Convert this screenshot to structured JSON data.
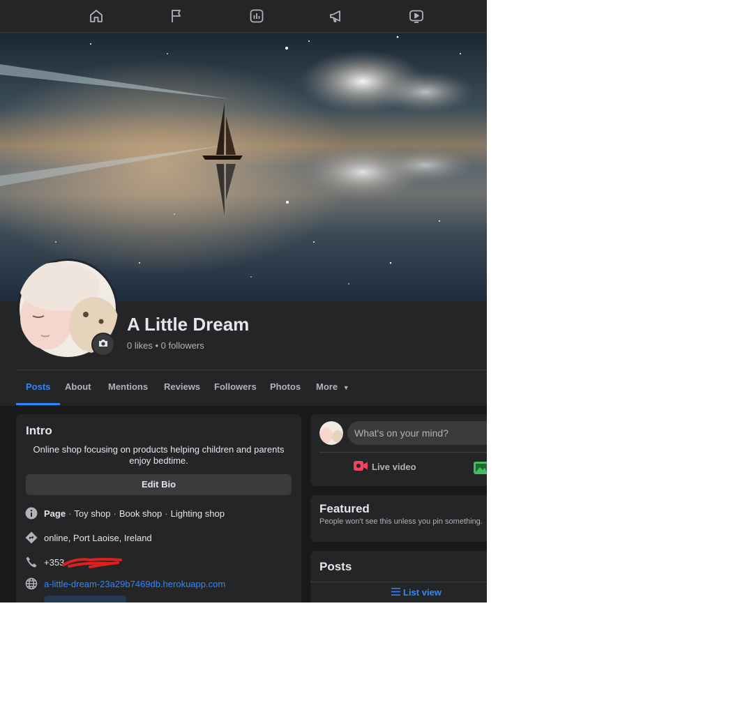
{
  "nav": {
    "icons": [
      "home-icon",
      "flag-icon",
      "insights-icon",
      "megaphone-icon",
      "watch-icon"
    ]
  },
  "profile": {
    "name": "A Little Dream",
    "stats": "0 likes • 0 followers"
  },
  "tabs": [
    {
      "label": "Posts",
      "active": true
    },
    {
      "label": "About"
    },
    {
      "label": "Mentions"
    },
    {
      "label": "Reviews"
    },
    {
      "label": "Followers"
    },
    {
      "label": "Photos"
    },
    {
      "label": "More"
    }
  ],
  "intro": {
    "title": "Intro",
    "bio": "Online shop focusing on products helping children and parents enjoy bedtime.",
    "edit_bio": "Edit Bio",
    "category_prefix": "Page",
    "categories": [
      "Toy shop",
      "Book shop",
      "Lighting shop"
    ],
    "location": "online, Port Laoise, Ireland",
    "phone": "+353",
    "website": "a-little-dream-23a29b7469db.herokuapp.com"
  },
  "composer": {
    "placeholder": "What's on your mind?",
    "live_video": "Live video"
  },
  "featured": {
    "title": "Featured",
    "note": "People won't see this unless you pin something."
  },
  "posts": {
    "title": "Posts",
    "list_view": "List view"
  },
  "colors": {
    "background": "#18191a",
    "surface": "#242526",
    "accent": "#2d88ff",
    "text_primary": "#e4e6eb",
    "text_secondary": "#b0b3b8",
    "live_red": "#f3425f",
    "photo_green": "#45bd62"
  }
}
